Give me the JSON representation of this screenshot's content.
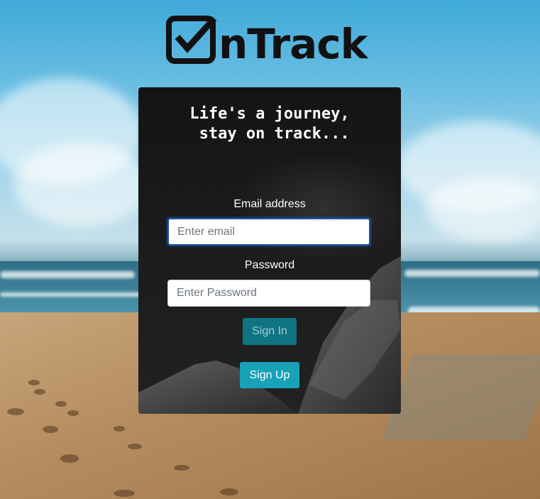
{
  "logo": {
    "text": "nTrack",
    "icon": "checkbox-check-icon"
  },
  "login_card": {
    "tagline": "Life's a journey,\n stay on track...",
    "email": {
      "label": "Email address",
      "placeholder": "Enter email",
      "value": ""
    },
    "password": {
      "label": "Password",
      "placeholder": "Enter Password",
      "value": ""
    },
    "sign_in_label": "Sign In",
    "sign_up_label": "Sign Up"
  },
  "colors": {
    "sign_in_button": "#0e7483",
    "sign_up_button": "#17a2b8",
    "focus_border": "#1f4fa0",
    "card_background": "#1a1a1a",
    "logo": "#111111"
  }
}
